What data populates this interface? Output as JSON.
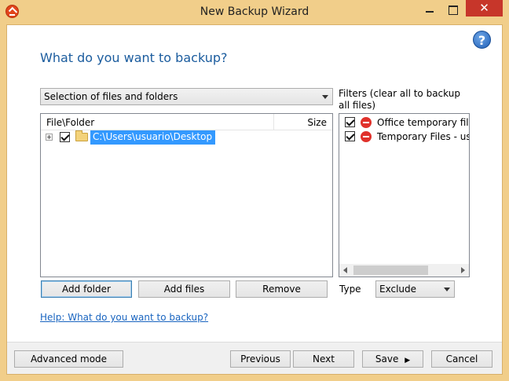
{
  "window": {
    "title": "New Backup Wizard",
    "close_glyph": "✕",
    "help_glyph": "?"
  },
  "page": {
    "heading": "What do you want to backup?"
  },
  "source_select": {
    "selected": "Selection of files and folders"
  },
  "tree": {
    "columns": {
      "file": "File\\Folder",
      "size": "Size"
    },
    "rows": [
      {
        "path": "C:\\Users\\usuario\\Desktop",
        "checked": true,
        "selected": true
      }
    ]
  },
  "filters": {
    "label": "Filters (clear all to backup all files)",
    "items": [
      {
        "label": "Office temporary files",
        "checked": true,
        "icon": "no-entry-icon"
      },
      {
        "label": "Temporary Files - use",
        "checked": true,
        "icon": "no-entry-icon"
      }
    ]
  },
  "actions": {
    "add_folder": "Add folder",
    "add_files": "Add files",
    "remove": "Remove"
  },
  "type": {
    "label": "Type",
    "selected": "Exclude"
  },
  "help_link": "Help: What do you want to backup?",
  "footer": {
    "advanced_mode": "Advanced mode",
    "previous": "Previous",
    "next": "Next",
    "save": "Save",
    "save_arrow": "▶",
    "cancel": "Cancel"
  },
  "colors": {
    "frame": "#f1ce8a",
    "heading": "#1b5c9e",
    "selection": "#3399ff",
    "close_button": "#c7362a",
    "link": "#1a65c0"
  }
}
